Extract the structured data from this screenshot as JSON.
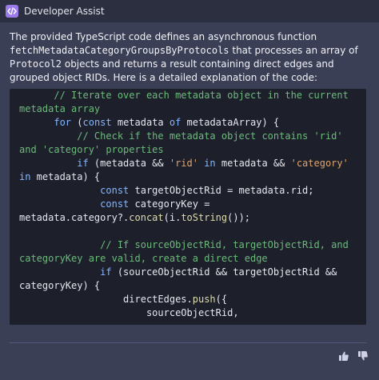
{
  "window": {
    "title": "Developer Assist"
  },
  "message": {
    "intro_1": "The provided TypeScript code defines an asynchronous function ",
    "intro_fn": "fetchMetadataCategoryGroupsByProtocols",
    "intro_2": " that processes an array of ",
    "intro_type": "Protocol2",
    "intro_3": " objects and returns a result containing direct edges and grouped object RIDs. Here is a detailed explanation of the code:"
  },
  "code": {
    "l1_comment": "      // Iterate over each metadata object in the current metadata array",
    "l2_indent": "      ",
    "l2_for": "for",
    "l2_paren": " (",
    "l2_const": "const",
    "l2_var": " metadata ",
    "l2_of": "of",
    "l2_rest": " metadataArray) {",
    "l3_comment": "          // Check if the metadata object contains 'rid' and 'category' properties",
    "l4_indent": "          ",
    "l4_if": "if",
    "l4_a": " (metadata && ",
    "l4_s1": "'rid'",
    "l4_in1": " in",
    "l4_b": " metadata && ",
    "l4_s2": "'category'",
    "l4_in2": " in",
    "l4_c": " metadata) {",
    "l5_indent": "              ",
    "l5_const": "const",
    "l5_rest": " targetObjectRid = metadata.rid;",
    "l6_indent": "              ",
    "l6_const": "const",
    "l6_a": " categoryKey = metadata.category?.",
    "l6_concat": "concat",
    "l6_b": "(i.",
    "l6_tostring": "toString",
    "l6_c": "());",
    "blank": " ",
    "l7_comment": "              // If sourceObjectRid, targetObjectRid, and categoryKey are valid, create a direct edge",
    "l8_indent": "              ",
    "l8_if": "if",
    "l8_rest": " (sourceObjectRid && targetObjectRid && categoryKey) {",
    "l9_indent": "                  ",
    "l9_a": "directEdges.",
    "l9_push": "push",
    "l9_b": "({",
    "l10": "                      sourceObjectRid,"
  },
  "actions": {
    "thumbs_up": "thumbs-up-icon",
    "thumbs_down": "thumbs-down-icon"
  },
  "colors": {
    "accent": "#9b7bea",
    "comment": "#6cba7b",
    "keyword": "#86b7ff",
    "string": "#e0a36a",
    "code_bg": "#1d1f2b"
  }
}
